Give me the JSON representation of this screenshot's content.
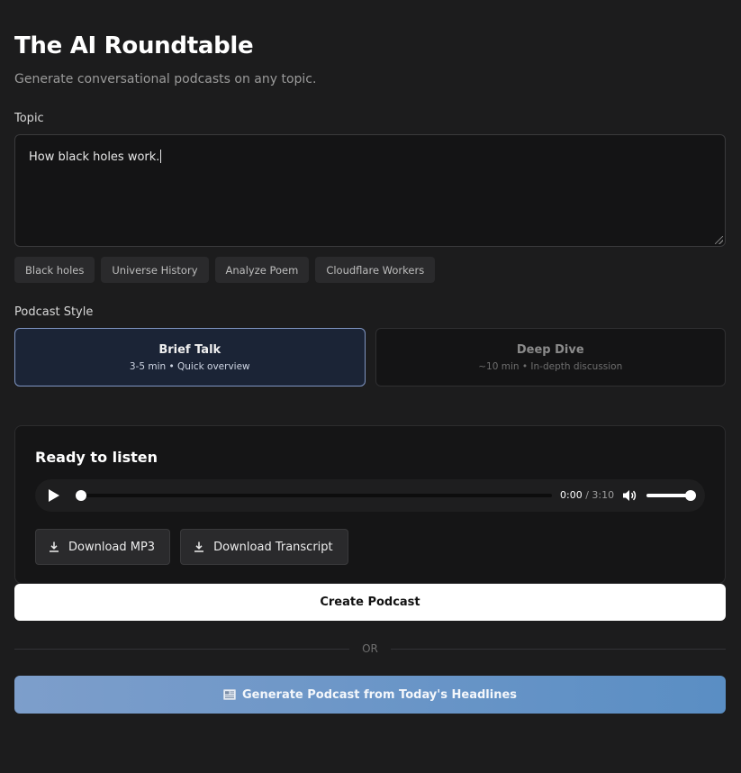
{
  "header": {
    "title": "The AI Roundtable",
    "subtitle": "Generate conversational podcasts on any topic."
  },
  "topic": {
    "label": "Topic",
    "value": "How black holes work."
  },
  "suggestions": [
    "Black holes",
    "Universe History",
    "Analyze Poem",
    "Cloudflare Workers"
  ],
  "style": {
    "label": "Podcast Style",
    "options": [
      {
        "name": "Brief Talk",
        "desc": "3-5 min • Quick overview",
        "selected": true
      },
      {
        "name": "Deep Dive",
        "desc": "~10 min • In-depth discussion",
        "selected": false
      }
    ]
  },
  "result": {
    "title": "Ready to listen",
    "player": {
      "current_time": "0:00",
      "separator": " / ",
      "duration": "3:10",
      "progress": 0,
      "volume": 1
    },
    "download_mp3_label": "Download MP3",
    "download_transcript_label": "Download Transcript"
  },
  "actions": {
    "create_label": "Create Podcast",
    "or_label": "OR",
    "headlines_label": "Generate Podcast from Today's Headlines"
  },
  "icons": {
    "play": "play-icon",
    "volume": "volume-icon",
    "download": "download-icon",
    "newspaper": "newspaper-icon"
  },
  "colors": {
    "background": "#1c1c1d",
    "selected_border": "#7f95c2",
    "headline_gradient_start": "#7d9ecb",
    "headline_gradient_end": "#5a8ec4"
  }
}
